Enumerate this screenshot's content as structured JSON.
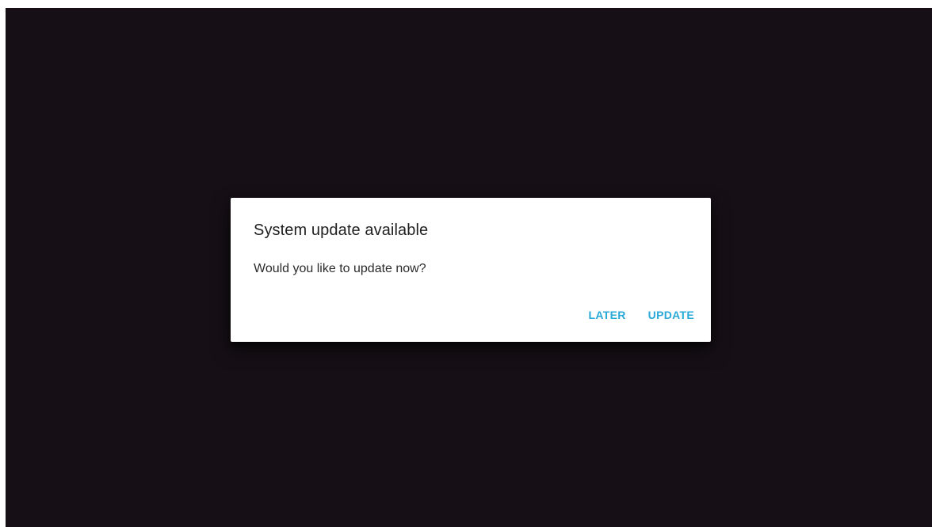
{
  "dialog": {
    "title": "System update available",
    "message": "Would you like to update now?",
    "actions": {
      "later_label": "LATER",
      "update_label": "UPDATE"
    }
  },
  "colors": {
    "background": "#161016",
    "dialog_surface": "#ffffff",
    "accent": "#29a9d8",
    "title_text": "#1f1f1f"
  }
}
